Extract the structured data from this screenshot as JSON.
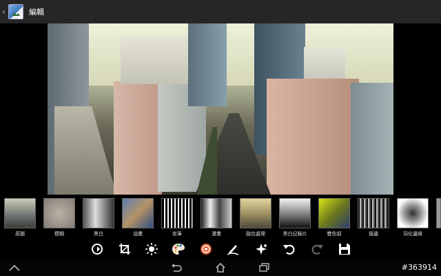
{
  "header": {
    "title": "編輯",
    "back_icon": "chevron-left-icon",
    "app_icon": "gallery-photo-icon"
  },
  "filters": [
    {
      "label": "原圖",
      "style": "original"
    },
    {
      "label": "模糊",
      "style": "blur"
    },
    {
      "label": "黑白",
      "style": "bw"
    },
    {
      "label": "油畫",
      "style": "oil"
    },
    {
      "label": "炭筆",
      "style": "charcoal"
    },
    {
      "label": "漫畫",
      "style": "comic"
    },
    {
      "label": "融合處理",
      "style": "fusion"
    },
    {
      "label": "黑白記錄片",
      "style": "documentary"
    },
    {
      "label": "雙色調",
      "style": "duotone"
    },
    {
      "label": "描邊",
      "style": "outline"
    },
    {
      "label": "羽化邊緣",
      "style": "vignette"
    }
  ],
  "tools": [
    {
      "name": "rotate-effects-icon"
    },
    {
      "name": "crop-icon"
    },
    {
      "name": "brightness-icon"
    },
    {
      "name": "palette-icon"
    },
    {
      "name": "effects-icon"
    },
    {
      "name": "draw-icon"
    },
    {
      "name": "sparkle-icon"
    },
    {
      "name": "undo-icon"
    },
    {
      "name": "redo-icon"
    },
    {
      "name": "save-icon"
    }
  ],
  "nav": {
    "home_up": "caret-up-icon",
    "back": "back-icon",
    "home": "home-icon",
    "recent": "recent-apps-icon"
  },
  "watermark": "#363914"
}
